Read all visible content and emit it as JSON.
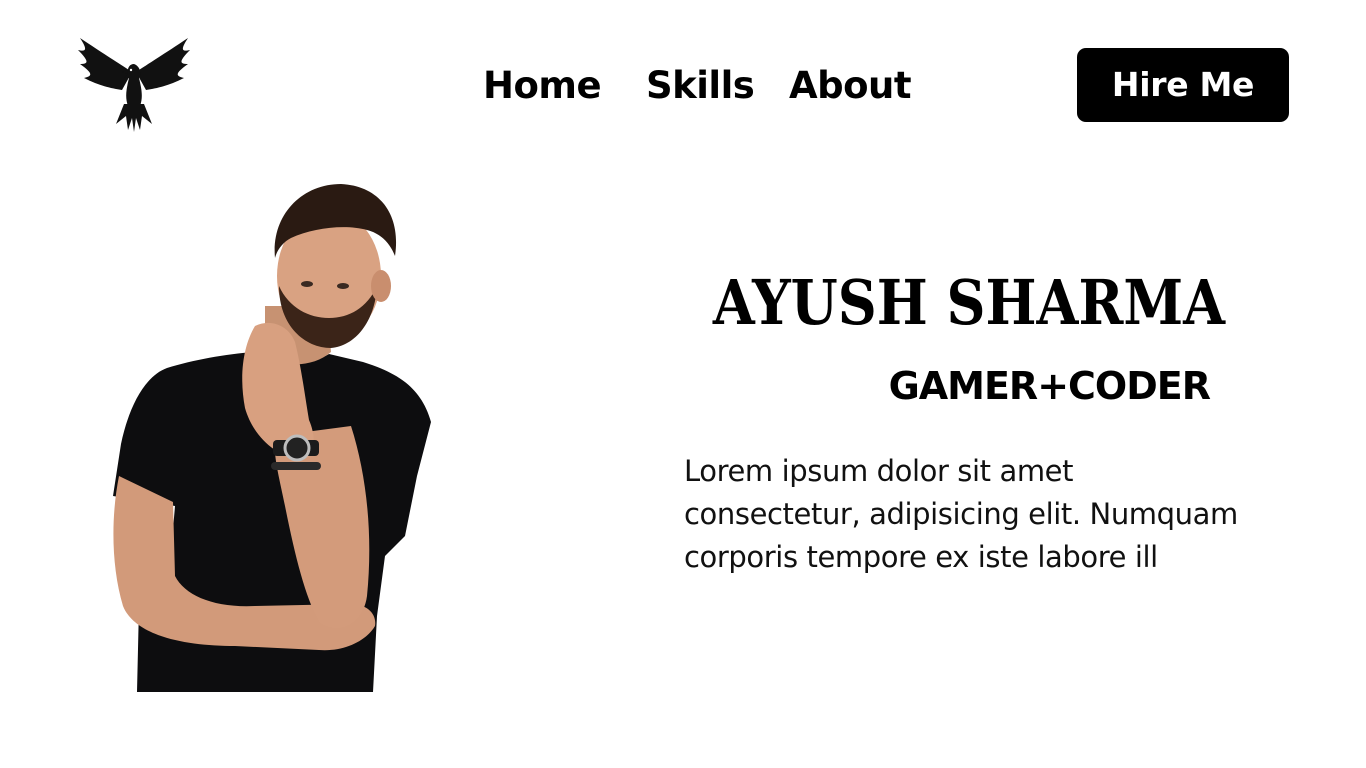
{
  "header": {
    "logo_icon": "eagle-icon",
    "nav": {
      "home": "Home",
      "skills": "Skills",
      "about": "About"
    },
    "cta_label": "Hire Me"
  },
  "hero": {
    "name": "AYUSH SHARMA",
    "tagline": "GAMER+CODER",
    "description": "Lorem ipsum dolor sit amet consectetur, adipisicing elit. Numquam corporis tempore ex iste labore ill",
    "portrait_icon": "person-portrait"
  },
  "colors": {
    "background": "#ffffff",
    "text": "#000000",
    "button_bg": "#000000",
    "button_text": "#ffffff"
  }
}
